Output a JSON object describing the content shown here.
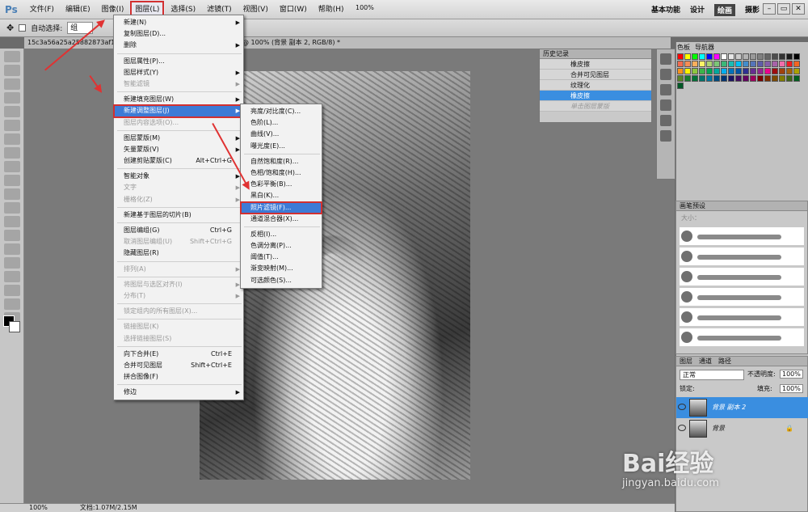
{
  "menubar": {
    "logo": "Ps",
    "items": [
      "文件(F)",
      "编辑(E)",
      "图像(I)",
      "图层(L)",
      "选择(S)",
      "滤镜(T)",
      "视图(V)",
      "窗口(W)",
      "帮助(H)"
    ],
    "zoom": "100%",
    "workspaces": [
      "基本功能",
      "设计",
      "绘画",
      "摄影"
    ]
  },
  "options": {
    "auto_select_label": "自动选择:",
    "auto_select_value": "组"
  },
  "doc_tab": {
    "file": "15c3a56a25a25882873af1",
    "title": "@ 100% (背景 副本 2, RGB/8) *"
  },
  "layer_menu": [
    {
      "label": "新建(N)",
      "arrow": true
    },
    {
      "label": "复制图层(D)..."
    },
    {
      "label": "删除",
      "arrow": true
    },
    {
      "sep": true
    },
    {
      "label": "图层属性(P)..."
    },
    {
      "label": "图层样式(Y)",
      "arrow": true
    },
    {
      "label": "智能滤镜",
      "disabled": true,
      "arrow": true
    },
    {
      "sep": true
    },
    {
      "label": "新建填充图层(W)",
      "arrow": true
    },
    {
      "label": "新建调整图层(J)",
      "arrow": true,
      "highlight": true
    },
    {
      "label": "图层内容选项(O)...",
      "disabled": true
    },
    {
      "sep": true
    },
    {
      "label": "图层蒙版(M)",
      "arrow": true
    },
    {
      "label": "矢量蒙版(V)",
      "arrow": true
    },
    {
      "label": "创建剪贴蒙版(C)",
      "shortcut": "Alt+Ctrl+G"
    },
    {
      "sep": true
    },
    {
      "label": "智能对象",
      "arrow": true
    },
    {
      "label": "文字",
      "disabled": true,
      "arrow": true
    },
    {
      "label": "栅格化(Z)",
      "disabled": true,
      "arrow": true
    },
    {
      "sep": true
    },
    {
      "label": "新建基于图层的切片(B)"
    },
    {
      "sep": true
    },
    {
      "label": "图层编组(G)",
      "shortcut": "Ctrl+G"
    },
    {
      "label": "取消图层编组(U)",
      "shortcut": "Shift+Ctrl+G",
      "disabled": true
    },
    {
      "label": "隐藏图层(R)"
    },
    {
      "sep": true
    },
    {
      "label": "排列(A)",
      "disabled": true,
      "arrow": true
    },
    {
      "sep": true
    },
    {
      "label": "将图层与选区对齐(I)",
      "disabled": true,
      "arrow": true
    },
    {
      "label": "分布(T)",
      "disabled": true,
      "arrow": true
    },
    {
      "sep": true
    },
    {
      "label": "锁定组内的所有图层(X)...",
      "disabled": true
    },
    {
      "sep": true
    },
    {
      "label": "链接图层(K)",
      "disabled": true
    },
    {
      "label": "选择链接图层(S)",
      "disabled": true
    },
    {
      "sep": true
    },
    {
      "label": "向下合并(E)",
      "shortcut": "Ctrl+E"
    },
    {
      "label": "合并可见图层",
      "shortcut": "Shift+Ctrl+E"
    },
    {
      "label": "拼合图像(F)"
    },
    {
      "sep": true
    },
    {
      "label": "修边",
      "arrow": true
    }
  ],
  "adjust_menu": [
    {
      "label": "亮度/对比度(C)..."
    },
    {
      "label": "色阶(L)..."
    },
    {
      "label": "曲线(V)..."
    },
    {
      "label": "曝光度(E)..."
    },
    {
      "sep": true
    },
    {
      "label": "自然饱和度(R)..."
    },
    {
      "label": "色相/饱和度(H)..."
    },
    {
      "label": "色彩平衡(B)..."
    },
    {
      "label": "黑白(K)..."
    },
    {
      "label": "照片滤镜(F)...",
      "highlight": true
    },
    {
      "label": "通道混合器(X)..."
    },
    {
      "sep": true
    },
    {
      "label": "反相(I)..."
    },
    {
      "label": "色调分离(P)..."
    },
    {
      "label": "阈值(T)..."
    },
    {
      "label": "渐变映射(M)..."
    },
    {
      "label": "可选颜色(S)..."
    }
  ],
  "history": {
    "tab": "历史记录",
    "rows": [
      {
        "label": "橡皮擦"
      },
      {
        "label": "合并可见图层"
      },
      {
        "label": "纹理化"
      },
      {
        "label": "橡皮擦",
        "selected": true
      },
      {
        "label": "单击图层蒙版",
        "disabled": true
      }
    ]
  },
  "swatch_tabs": [
    "色板",
    "导航器"
  ],
  "swatch_colors": [
    "#ff0000",
    "#ffff00",
    "#00ff00",
    "#00ffff",
    "#0000ff",
    "#ff00ff",
    "#ffffff",
    "#e6e6e6",
    "#cccccc",
    "#b3b3b3",
    "#999999",
    "#808080",
    "#666666",
    "#4d4d4d",
    "#333333",
    "#1a1a1a",
    "#000000",
    "#f26c4f",
    "#f68e55",
    "#fbaf5c",
    "#fff467",
    "#acd372",
    "#7cc576",
    "#3bb878",
    "#1abbb4",
    "#00bff3",
    "#438ccb",
    "#5574b9",
    "#605ca8",
    "#855fa8",
    "#a763a8",
    "#f06ea9",
    "#ed1c24",
    "#f26522",
    "#f7941d",
    "#fff200",
    "#8dc63f",
    "#39b54a",
    "#00a651",
    "#00a99d",
    "#00aeef",
    "#0072bc",
    "#0054a6",
    "#2e3192",
    "#662d91",
    "#92278f",
    "#ec008c",
    "#9e0b0f",
    "#a0410d",
    "#a3620a",
    "#aba000",
    "#598527",
    "#1a7b30",
    "#007236",
    "#00746b",
    "#0076a3",
    "#004b80",
    "#003471",
    "#1b1464",
    "#440e62",
    "#630460",
    "#9e005d",
    "#790000",
    "#7b2e00",
    "#7d4900",
    "#827b00",
    "#406618",
    "#005e20",
    "#005826"
  ],
  "brush_panel": {
    "tab": "画笔预设",
    "size_label": "大小："
  },
  "layers": {
    "tabs": [
      "图层",
      "通道",
      "路径"
    ],
    "blend": "正常",
    "opacity_label": "不透明度:",
    "opacity": "100%",
    "lock_label": "锁定:",
    "fill_label": "填充:",
    "fill": "100%",
    "rows": [
      {
        "name": "背景 副本 2",
        "selected": true
      },
      {
        "name": "背景"
      }
    ]
  },
  "status": {
    "zoom": "100%",
    "doc": "文档:1.07M/2.15M"
  },
  "watermark": {
    "text": "Bai经验",
    "url": "jingyan.baidu.com"
  }
}
